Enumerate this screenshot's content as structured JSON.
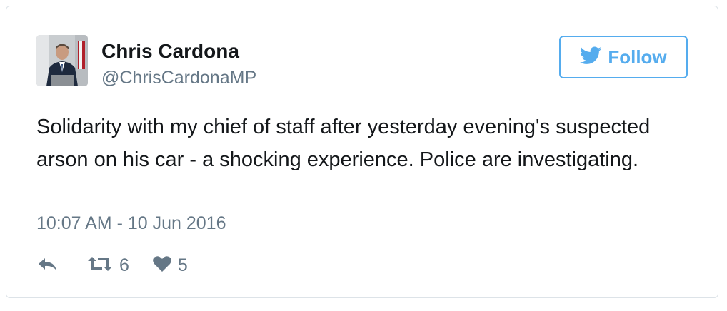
{
  "tweet": {
    "author": {
      "name": "Chris Cardona",
      "handle": "@ChrisCardonaMP"
    },
    "follow_label": "Follow",
    "text": "Solidarity with my chief of staff after yesterday evening's suspected arson on his car - a shocking experience. Police are investigating.",
    "timestamp": "10:07 AM - 10 Jun 2016",
    "actions": {
      "retweet_count": "6",
      "like_count": "5"
    }
  },
  "icons": {
    "follow": "twitter-bird-icon",
    "reply": "reply-icon",
    "retweet": "retweet-icon",
    "like": "heart-icon"
  },
  "colors": {
    "brand": "#55acee",
    "text": "#14171a",
    "muted": "#657786",
    "border": "#dde3e8"
  }
}
